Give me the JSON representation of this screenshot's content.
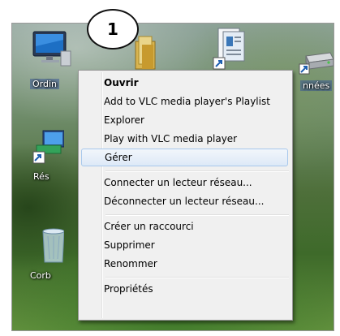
{
  "badge": {
    "number": "1"
  },
  "desktop": {
    "icons": [
      {
        "label": "Ordin",
        "icon": "computer-icon"
      },
      {
        "label": "",
        "icon": "folder-icon"
      },
      {
        "label": "",
        "icon": "document-shortcut-icon"
      },
      {
        "label": "nnées",
        "icon": "drive-icon"
      },
      {
        "label": "Rés",
        "icon": "network-icon"
      },
      {
        "label": "Corb",
        "icon": "recycle-bin-icon"
      }
    ]
  },
  "context_menu": {
    "items": [
      {
        "label": "Ouvrir",
        "bold": true
      },
      {
        "label": "Add to VLC media player's Playlist"
      },
      {
        "label": "Explorer"
      },
      {
        "label": "Play with VLC media player"
      },
      {
        "label": "Gérer",
        "highlighted": true
      },
      {
        "label": "Connecter un lecteur réseau..."
      },
      {
        "label": "Déconnecter un lecteur réseau..."
      },
      {
        "label": "Créer un raccourci"
      },
      {
        "label": "Supprimer"
      },
      {
        "label": "Renommer"
      },
      {
        "label": "Propriétés"
      }
    ]
  }
}
